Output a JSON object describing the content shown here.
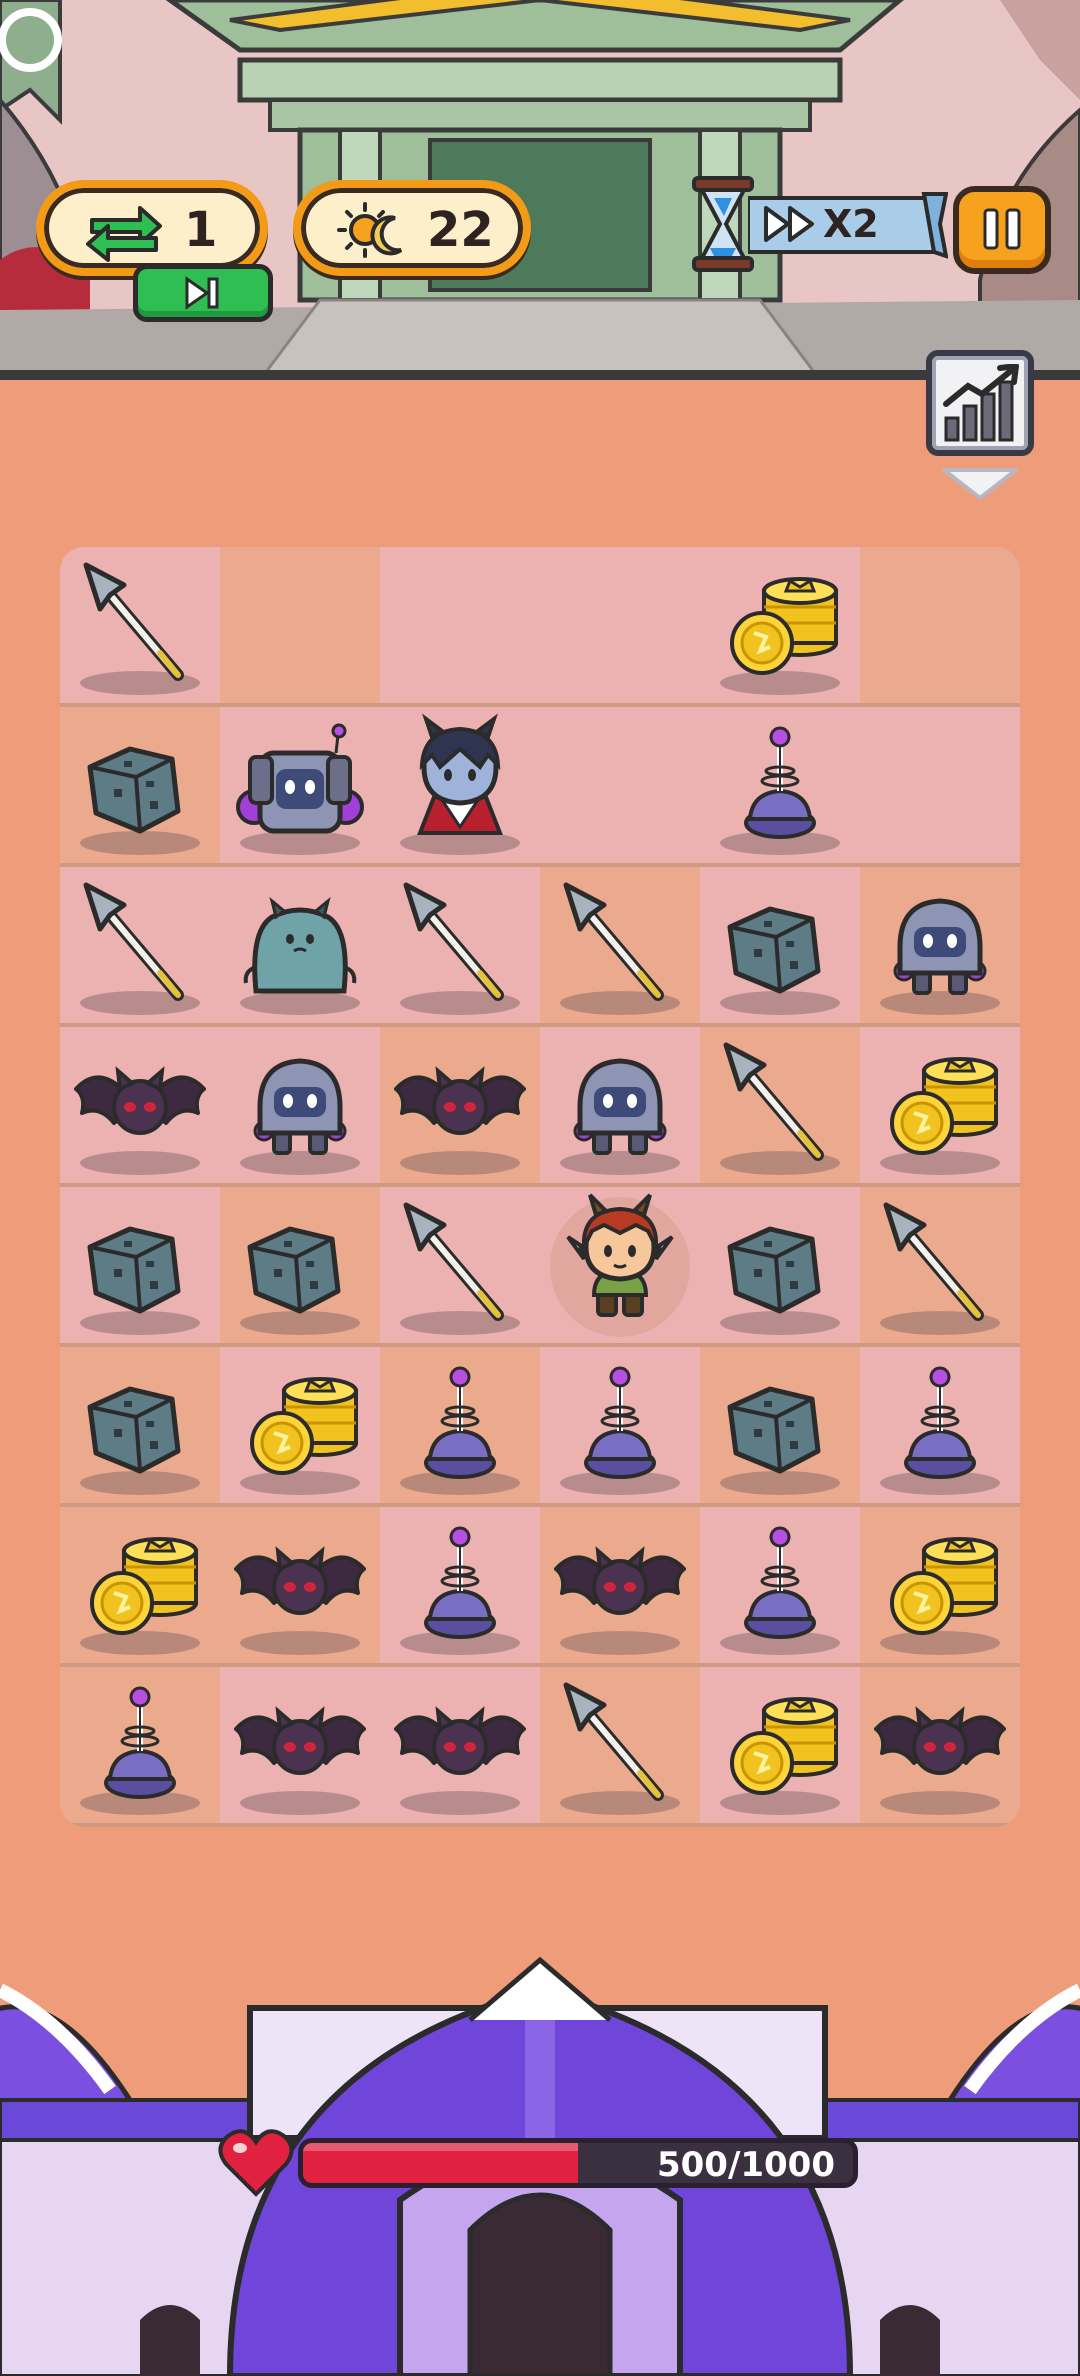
{
  "hud": {
    "swaps": "1",
    "energy": "22",
    "speed": "X2"
  },
  "castle": {
    "health_text": "500/1000",
    "health_fraction": 0.5
  },
  "board": {
    "rows": 8,
    "cols": 6,
    "grid": [
      [
        "spear",
        "",
        "",
        "",
        "coins",
        ""
      ],
      [
        "rock",
        "robot",
        "vampire",
        "",
        "tower",
        ""
      ],
      [
        "spear",
        "blob",
        "spear",
        "spear",
        "rock",
        "knight"
      ],
      [
        "bat",
        "knight",
        "bat",
        "knight",
        "spear",
        "coins"
      ],
      [
        "rock",
        "rock",
        "spear",
        "hero",
        "rock",
        "spear"
      ],
      [
        "rock",
        "coins",
        "tower",
        "tower",
        "rock",
        "tower"
      ],
      [
        "coins",
        "bat",
        "tower",
        "bat",
        "tower",
        "coins"
      ],
      [
        "tower",
        "bat",
        "bat",
        "spear",
        "coins",
        "bat"
      ]
    ],
    "pattern": [
      [
        "pink",
        "peach",
        "pink",
        "pink",
        "pink",
        "peach"
      ],
      [
        "peach",
        "pink",
        "pink",
        "pink",
        "pink",
        "pink"
      ],
      [
        "pink",
        "pink",
        "pink",
        "peach",
        "pink",
        "peach"
      ],
      [
        "pink",
        "pink",
        "peach",
        "pink",
        "peach",
        "pink"
      ],
      [
        "pink",
        "peach",
        "pink",
        "pink",
        "pink",
        "peach"
      ],
      [
        "peach",
        "pink",
        "peach",
        "pink",
        "peach",
        "pink"
      ],
      [
        "peach",
        "peach",
        "pink",
        "peach",
        "pink",
        "peach"
      ],
      [
        "peach",
        "pink",
        "pink",
        "peach",
        "pink",
        "peach"
      ]
    ]
  }
}
